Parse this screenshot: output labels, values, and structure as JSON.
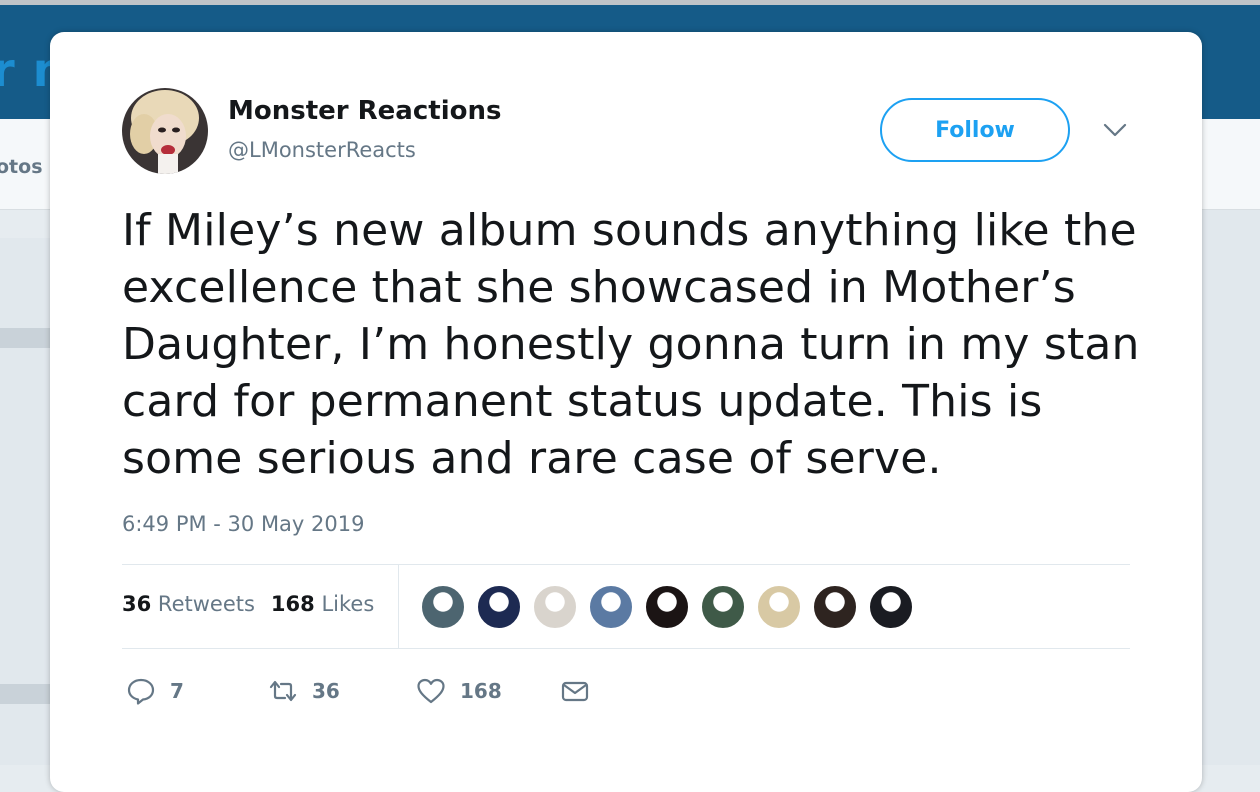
{
  "background": {
    "banner_text": "r m",
    "nav_text": "otos"
  },
  "tweet": {
    "display_name": "Monster Reactions",
    "handle": "@LMonsterReacts",
    "follow_label": "Follow",
    "text": "If Miley’s new album sounds anything like the excellence that she showcased in Mother’s Daughter, I’m honestly gonna turn in my stan card for permanent status update. This is some serious and rare case of serve.",
    "timestamp": "6:49 PM - 30 May 2019",
    "retweets_count": "36",
    "retweets_label": "Retweets",
    "likes_count": "168",
    "likes_label": "Likes",
    "liker_avatar_colors": [
      "#4d6570",
      "#1d2a52",
      "#d9d4cd",
      "#5b7aa3",
      "#1b1414",
      "#3f5a48",
      "#d8c9a4",
      "#2e2420",
      "#1a1c22"
    ],
    "actions": {
      "reply_count": "7",
      "retweet_count": "36",
      "like_count": "168"
    }
  },
  "colors": {
    "accent": "#1da1f2",
    "secondary_text": "#657786",
    "banner": "#155b88"
  }
}
